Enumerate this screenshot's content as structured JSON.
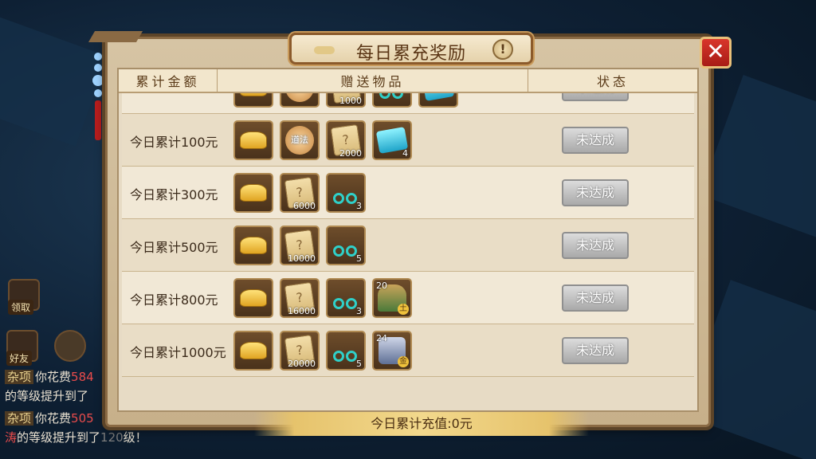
{
  "dialog": {
    "title": "每日累充奖励",
    "info_icon": "!",
    "close_icon": "✕",
    "columns": [
      "累计金额",
      "赠送物品",
      "状态"
    ],
    "footer": "今日累计充值:0元"
  },
  "rows": [
    {
      "label": "",
      "status": "未达成",
      "items": [
        {
          "icon": "gold-ingot-icon",
          "count": ""
        },
        {
          "icon": "daofa-gourd-icon",
          "text": "道法",
          "count": ""
        },
        {
          "icon": "skill-scroll-icon",
          "count": "1000"
        },
        {
          "icon": "bracelet-icon",
          "count": ""
        },
        {
          "icon": "gem-pack-icon",
          "count": ""
        }
      ]
    },
    {
      "label": "今日累计100元",
      "status": "未达成",
      "items": [
        {
          "icon": "gold-ingot-icon",
          "count": ""
        },
        {
          "icon": "daofa-gourd-icon",
          "text": "道法",
          "count": ""
        },
        {
          "icon": "skill-scroll-icon",
          "count": "2000"
        },
        {
          "icon": "gem-pack-icon",
          "count": "4"
        }
      ]
    },
    {
      "label": "今日累计300元",
      "status": "未达成",
      "items": [
        {
          "icon": "gold-ingot-icon",
          "count": ""
        },
        {
          "icon": "skill-scroll-icon",
          "count": "6000"
        },
        {
          "icon": "bracelet-icon",
          "count": "3"
        }
      ]
    },
    {
      "label": "今日累计500元",
      "status": "未达成",
      "items": [
        {
          "icon": "gold-ingot-icon",
          "count": ""
        },
        {
          "icon": "skill-scroll-icon",
          "count": "10000"
        },
        {
          "icon": "bracelet-icon",
          "count": "5"
        }
      ]
    },
    {
      "label": "今日累计800元",
      "status": "未达成",
      "items": [
        {
          "icon": "gold-ingot-icon",
          "count": ""
        },
        {
          "icon": "skill-scroll-icon",
          "count": "16000"
        },
        {
          "icon": "bracelet-icon",
          "count": "3"
        },
        {
          "icon": "mount-icon",
          "level": "20",
          "element": "土",
          "count": ""
        }
      ]
    },
    {
      "label": "今日累计1000元",
      "status": "未达成",
      "items": [
        {
          "icon": "gold-ingot-icon",
          "count": ""
        },
        {
          "icon": "skill-scroll-icon",
          "count": "20000"
        },
        {
          "icon": "bracelet-icon",
          "count": "5"
        },
        {
          "icon": "spirit-stone-icon",
          "level": "24",
          "element": "金",
          "count": ""
        }
      ]
    }
  ],
  "sidebar": {
    "claim_label": "领取",
    "friends_label": "好友"
  },
  "chat": [
    {
      "tag": "杂项",
      "text": "你花费",
      "highlight": "584",
      "rest": ""
    },
    {
      "tag": "",
      "text": "的等级提升到了",
      "highlight": "",
      "rest": ""
    },
    {
      "tag": "杂项",
      "text": "你花费",
      "highlight": "505",
      "rest": ""
    },
    {
      "tag": "",
      "prefix": "涛",
      "text": "的等级提升到了",
      "highlight": "120",
      "rest": "级！"
    }
  ]
}
